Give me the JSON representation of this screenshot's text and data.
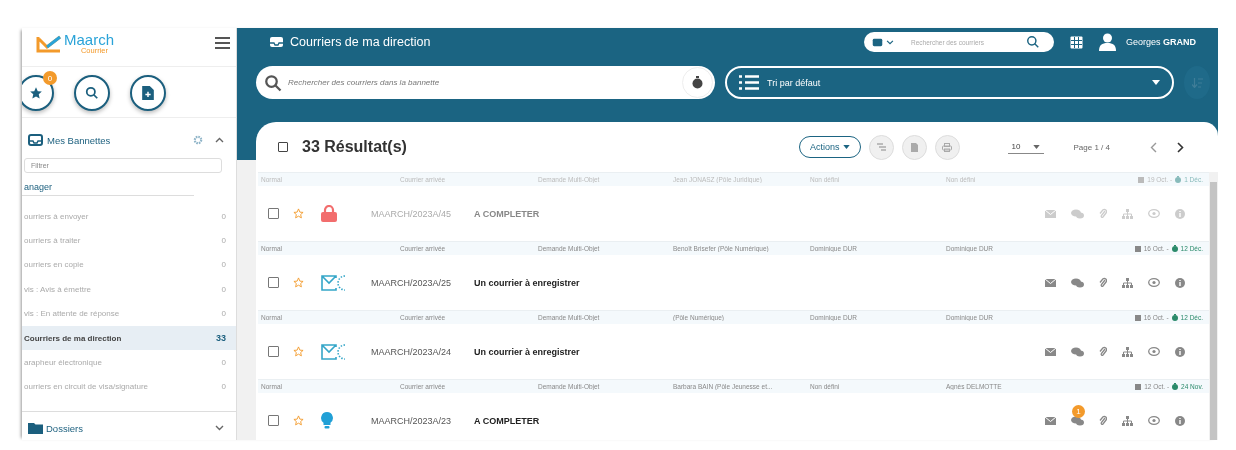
{
  "app": {
    "logo": "Maarch",
    "logo_sub": "Courrier"
  },
  "quick_actions": {
    "favorites_badge": "0"
  },
  "sidebar": {
    "baskets_title": "Mes Bannettes",
    "expanded": true,
    "filter_placeholder": "Filtrer",
    "group": "anager",
    "items": [
      {
        "label": "ourriers à envoyer",
        "count": "0",
        "selected": false
      },
      {
        "label": "ourriers à traiter",
        "count": "0",
        "selected": false
      },
      {
        "label": "ourriers en copie",
        "count": "0",
        "selected": false
      },
      {
        "label": "vis : Avis à émettre",
        "count": "0",
        "selected": false
      },
      {
        "label": "vis : En attente de réponse",
        "count": "0",
        "selected": false
      },
      {
        "label": "Courriers de ma direction",
        "count": "33",
        "selected": true
      },
      {
        "label": "arapheur électronique",
        "count": "0",
        "selected": false
      },
      {
        "label": "ourriers en circuit de visa/signature",
        "count": "0",
        "selected": false
      }
    ],
    "folders_title": "Dossiers",
    "folders_expanded": false
  },
  "header": {
    "title": "Courriers de ma direction",
    "search_placeholder": "Rechercher des courriers",
    "user_first": "Georges",
    "user_last": "GRAND"
  },
  "toolbar": {
    "search_placeholder": "Rechercher des courriers dans la bannette",
    "sort": "Tri par défaut"
  },
  "results": {
    "all_checked": false,
    "title": "33 Résultat(s)",
    "actions": "Actions",
    "per_page": "10",
    "page": "Page 1 / 4"
  },
  "rows": [
    {
      "priority": "Normal",
      "category": "Courrier arrivée",
      "doctype": "Demande Multi-Objet",
      "entity": "Jean JONASZ (Pôle Juridique)",
      "user": "Non défini",
      "destination": "Non défini",
      "date": "19 Oct. -",
      "due": "1 Déc.",
      "kind": "lock",
      "chrono": "MAARCH/2023A/45",
      "subject": "A COMPLETER",
      "locked": true,
      "checked": false,
      "favorite": false
    },
    {
      "priority": "Normal",
      "category": "Courrier arrivée",
      "doctype": "Demande Multi-Objet",
      "entity": "Benoît Brisefer (Pôle Numérique)",
      "user": "Dominique DUR",
      "destination": "Dominique DUR",
      "date": "16 Oct. -",
      "due": "12 Déc.",
      "kind": "mail",
      "chrono": "MAARCH/2023A/25",
      "subject": "Un courrier à enregistrer",
      "locked": false,
      "checked": false,
      "favorite": false
    },
    {
      "priority": "Normal",
      "category": "Courrier arrivée",
      "doctype": "Demande Multi-Objet",
      "entity": "(Pôle Numérique)",
      "user": "Dominique DUR",
      "destination": "Dominique DUR",
      "date": "16 Oct. -",
      "due": "12 Déc.",
      "kind": "mail",
      "chrono": "MAARCH/2023A/24",
      "subject": "Un courrier à enregistrer",
      "locked": false,
      "checked": false,
      "favorite": false
    },
    {
      "priority": "Normal",
      "category": "Courrier arrivée",
      "doctype": "Demande Multi-Objet",
      "entity": "Barbara BAIN (Pôle Jeunesse et...",
      "user": "Non défini",
      "destination": "Agnès DELMOTTE",
      "date": "12 Oct. -",
      "due": "24 Nov.",
      "kind": "bulb",
      "chrono": "MAARCH/2023A/23",
      "subject": "A COMPLETER",
      "locked": false,
      "checked": false,
      "favorite": false,
      "notes_badge": "1"
    }
  ]
}
